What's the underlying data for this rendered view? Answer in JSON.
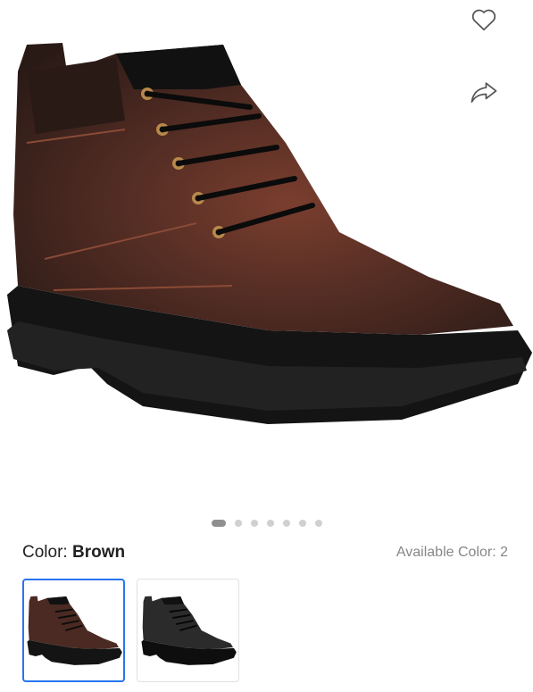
{
  "product": {
    "image_alt": "Brown leather lace-up ankle boot",
    "carousel": {
      "total_images": 7,
      "active_index": 0
    }
  },
  "actions": {
    "wishlist_icon": "heart-outline-icon",
    "share_icon": "share-arrow-icon"
  },
  "color": {
    "label": "Color: ",
    "selected": "Brown",
    "available_label": "Available Color: 2",
    "options": [
      {
        "name": "Brown",
        "hex": "#4a2a22",
        "selected": true
      },
      {
        "name": "Black",
        "hex": "#2b2b2b",
        "selected": false
      }
    ]
  },
  "colors": {
    "accent": "#2874f0",
    "muted_text": "#878787"
  }
}
